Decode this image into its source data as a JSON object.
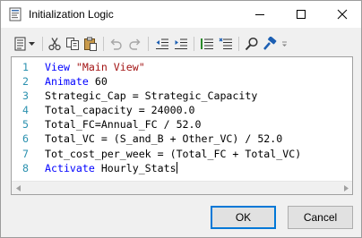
{
  "window": {
    "title": "Initialization Logic"
  },
  "toolbar": {
    "items": [
      {
        "icon": "line-format-icon"
      },
      {
        "icon": "dropdown-arrow-icon"
      },
      {
        "icon": "cut-icon"
      },
      {
        "icon": "copy-icon"
      },
      {
        "icon": "paste-icon"
      },
      {
        "icon": "undo-icon"
      },
      {
        "icon": "redo-icon"
      },
      {
        "icon": "outdent-icon"
      },
      {
        "icon": "indent-icon"
      },
      {
        "icon": "comment-icon"
      },
      {
        "icon": "uncomment-icon"
      },
      {
        "icon": "find-icon"
      },
      {
        "icon": "build-icon"
      },
      {
        "icon": "overflow-icon"
      }
    ]
  },
  "editor": {
    "lines": [
      {
        "num": "1",
        "kw": "View",
        "str": "\"Main View\"",
        "rest": ""
      },
      {
        "num": "2",
        "kw": "Animate",
        "str": "",
        "rest": " 60"
      },
      {
        "num": "3",
        "kw": "",
        "str": "",
        "rest": "Strategic_Cap = Strategic_Capacity"
      },
      {
        "num": "4",
        "kw": "",
        "str": "",
        "rest": "Total_capacity = 24000.0"
      },
      {
        "num": "5",
        "kw": "",
        "str": "",
        "rest": "Total_FC=Annual_FC / 52.0"
      },
      {
        "num": "6",
        "kw": "",
        "str": "",
        "rest": "Total_VC = (S_and_B + Other_VC) / 52.0"
      },
      {
        "num": "7",
        "kw": "",
        "str": "",
        "rest": "Tot_cost_per_week = (Total_FC + Total_VC)"
      },
      {
        "num": "8",
        "kw": "Activate",
        "str": "",
        "rest": " Hourly_Stats"
      }
    ]
  },
  "buttons": {
    "ok": "OK",
    "cancel": "Cancel"
  },
  "colors": {
    "keyword": "#0000ff",
    "string": "#a31515",
    "line_number": "#2b91af",
    "default_button_border": "#0078d7"
  }
}
